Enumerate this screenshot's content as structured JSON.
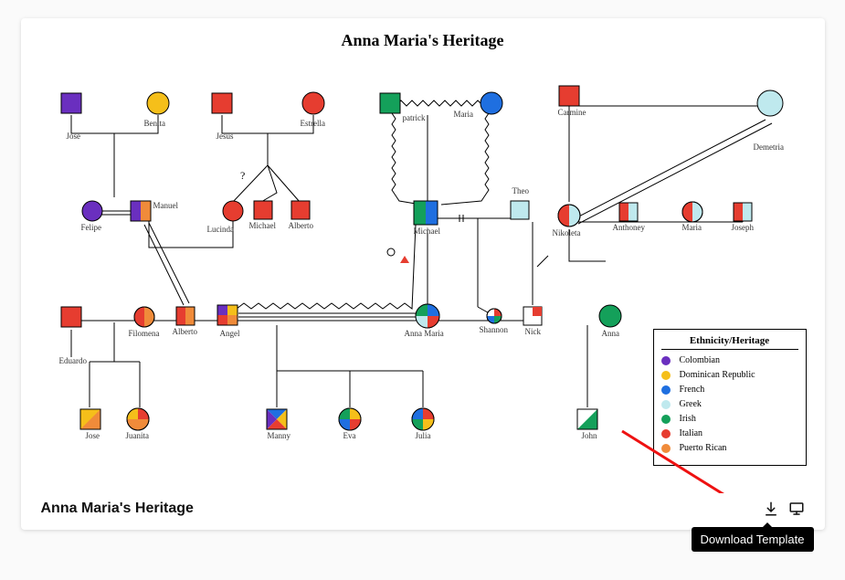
{
  "diagram": {
    "title": "Anna Maria's Heritage",
    "footer_title": "Anna Maria's Heritage",
    "colors": {
      "colombian": "#6a2fbf",
      "dominican": "#f5bf1a",
      "french": "#1f6fe0",
      "greek": "#bfe9ee",
      "irish": "#14a05a",
      "italian": "#e63d30",
      "puerto_rican": "#f08b3a"
    },
    "legend": {
      "title": "Ethnicity/Heritage",
      "items": [
        {
          "label": "Colombian",
          "color": "#6a2fbf"
        },
        {
          "label": "Dominican Republic",
          "color": "#f5bf1a"
        },
        {
          "label": "French",
          "color": "#1f6fe0"
        },
        {
          "label": "Greek",
          "color": "#bfe9ee"
        },
        {
          "label": "Irish",
          "color": "#14a05a"
        },
        {
          "label": "Italian",
          "color": "#e63d30"
        },
        {
          "label": "Puerto Rican",
          "color": "#f08b3a"
        }
      ]
    },
    "people": {
      "jose1": "Jose",
      "benita": "Benita",
      "jesus": "Jesus",
      "estrella": "Estrella",
      "patrick": "patrick",
      "maria": "Maria",
      "carmine": "Carmine",
      "demetria": "Demetria",
      "felipe": "Felipe",
      "manuel": "Manuel",
      "lucinda": "Lucinda",
      "michael1": "Michael",
      "alberto1": "Alberto",
      "michael2": "Michael",
      "theo": "Theo",
      "nikoleta": "Nikoleta",
      "anthoney": "Anthoney",
      "maria2": "Maria",
      "joseph": "Joseph",
      "eduardo": "Eduardo",
      "filomena": "Filomena",
      "alberto2": "Alberto",
      "angel": "Angel",
      "anna_maria": "Anna Maria",
      "shannon": "Shannon",
      "nick": "Nick",
      "anna": "Anna",
      "jose2": "Jose",
      "juanita": "Juanita",
      "manny": "Manny",
      "eva": "Eva",
      "julia": "Julia",
      "john": "John"
    }
  },
  "tooltip": "Download Template"
}
